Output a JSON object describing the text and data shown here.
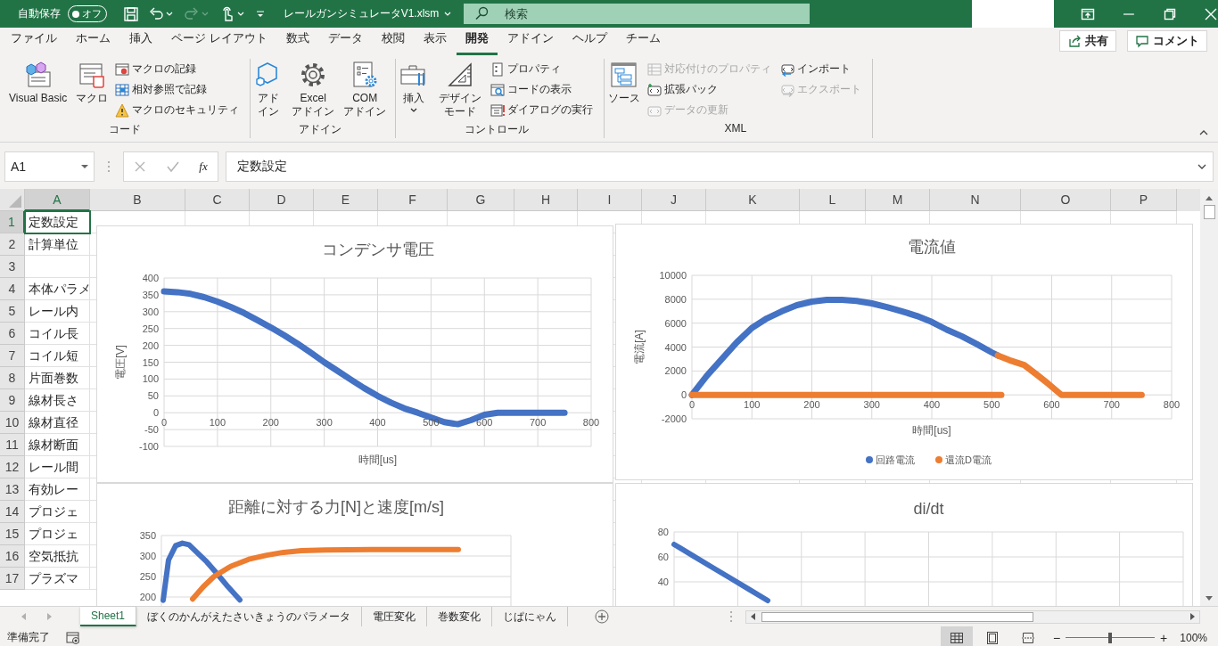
{
  "title_bar": {
    "autosave_label": "自動保存",
    "autosave_toggle": {
      "label": "オフ",
      "on": false
    },
    "file_name": "レールガンシミュレータV1.xlsm",
    "search": {
      "placeholder": "検索"
    }
  },
  "ribbon_tabs": [
    {
      "label": "ファイル",
      "selected": false
    },
    {
      "label": "ホーム",
      "selected": false
    },
    {
      "label": "挿入",
      "selected": false
    },
    {
      "label": "ページ レイアウト",
      "selected": false
    },
    {
      "label": "数式",
      "selected": false
    },
    {
      "label": "データ",
      "selected": false
    },
    {
      "label": "校閲",
      "selected": false
    },
    {
      "label": "表示",
      "selected": false
    },
    {
      "label": "開発",
      "selected": true
    },
    {
      "label": "アドイン",
      "selected": false
    },
    {
      "label": "ヘルプ",
      "selected": false
    },
    {
      "label": "チーム",
      "selected": false
    }
  ],
  "share_button": "共有",
  "comment_button": "コメント",
  "ribbon_groups": [
    {
      "label": "コード",
      "columns": [
        {
          "kind": "large",
          "items": [
            {
              "label": "Visual Basic",
              "disabled": false,
              "dropdown": false
            }
          ]
        },
        {
          "kind": "large",
          "items": [
            {
              "label": "マクロ",
              "disabled": false,
              "dropdown": false
            }
          ]
        },
        {
          "kind": "small",
          "items": [
            {
              "label": "マクロの記録",
              "disabled": false
            },
            {
              "label": "相対参照で記録",
              "disabled": false
            },
            {
              "label": "マクロのセキュリティ",
              "disabled": false
            }
          ]
        }
      ]
    },
    {
      "label": "アドイン",
      "columns": [
        {
          "kind": "large",
          "items": [
            {
              "label": "アドイン",
              "disabled": false,
              "dropdown": false
            }
          ]
        },
        {
          "kind": "large",
          "items": [
            {
              "label": "Excel\nアドイン",
              "disabled": false,
              "dropdown": false
            }
          ]
        },
        {
          "kind": "large",
          "items": [
            {
              "label": "COM\nアドイン",
              "disabled": false,
              "dropdown": false
            }
          ]
        }
      ]
    },
    {
      "label": "コントロール",
      "columns": [
        {
          "kind": "large",
          "items": [
            {
              "label": "挿入",
              "disabled": false,
              "dropdown": true
            }
          ]
        },
        {
          "kind": "large",
          "items": [
            {
              "label": "デザインモード",
              "disabled": false,
              "dropdown": false
            }
          ]
        },
        {
          "kind": "small",
          "items": [
            {
              "label": "プロパティ",
              "disabled": false
            },
            {
              "label": "コードの表示",
              "disabled": false
            },
            {
              "label": "ダイアログの実行",
              "disabled": false
            }
          ]
        }
      ]
    },
    {
      "label": "XML",
      "columns": [
        {
          "kind": "large",
          "items": [
            {
              "label": "ソース",
              "disabled": false,
              "dropdown": false
            }
          ]
        },
        {
          "kind": "small",
          "items": [
            {
              "label": "対応付けのプロパティ",
              "disabled": true
            },
            {
              "label": "拡張パック",
              "disabled": false
            },
            {
              "label": "データの更新",
              "disabled": true
            }
          ]
        },
        {
          "kind": "small",
          "items": [
            {
              "label": "インポート",
              "disabled": false
            },
            {
              "label": "エクスポート",
              "disabled": true
            }
          ]
        }
      ]
    }
  ],
  "formula_bar": {
    "name_box": "A1",
    "function_button": "fx",
    "formula": "定数設定"
  },
  "columns": [
    {
      "label": "A",
      "selected": true
    },
    {
      "label": "B",
      "selected": false
    },
    {
      "label": "C",
      "selected": false
    },
    {
      "label": "D",
      "selected": false
    },
    {
      "label": "E",
      "selected": false
    },
    {
      "label": "F",
      "selected": false
    },
    {
      "label": "G",
      "selected": false
    },
    {
      "label": "H",
      "selected": false
    },
    {
      "label": "I",
      "selected": false
    },
    {
      "label": "J",
      "selected": false
    },
    {
      "label": "K",
      "selected": false
    },
    {
      "label": "L",
      "selected": false
    },
    {
      "label": "M",
      "selected": false
    },
    {
      "label": "N",
      "selected": false
    },
    {
      "label": "O",
      "selected": false
    },
    {
      "label": "P",
      "selected": false
    }
  ],
  "rows": [
    {
      "header": "1",
      "selected": true,
      "column_a": "定数設定"
    },
    {
      "header": "2",
      "selected": false,
      "column_a": "計算単位"
    },
    {
      "header": "3",
      "selected": false
    },
    {
      "header": "4",
      "selected": false,
      "column_a": "本体パラメ"
    },
    {
      "header": "5",
      "selected": false,
      "column_a": "レール内"
    },
    {
      "header": "6",
      "selected": false,
      "column_a": "コイル長"
    },
    {
      "header": "7",
      "selected": false,
      "column_a": "コイル短"
    },
    {
      "header": "8",
      "selected": false,
      "column_a": "片面巻数"
    },
    {
      "header": "9",
      "selected": false,
      "column_a": "線材長さ"
    },
    {
      "header": "10",
      "selected": false,
      "column_a": "線材直径"
    },
    {
      "header": "11",
      "selected": false,
      "column_a": "線材断面"
    },
    {
      "header": "12",
      "selected": false,
      "column_a": "レール間"
    },
    {
      "header": "13",
      "selected": false,
      "column_a": "有効レー"
    },
    {
      "header": "14",
      "selected": false,
      "column_a": "プロジェ"
    },
    {
      "header": "15",
      "selected": false,
      "column_a": "プロジェ"
    },
    {
      "header": "16",
      "selected": false,
      "column_a": "空気抵抗"
    },
    {
      "header": "17",
      "selected": false,
      "column_a": "プラズマ"
    }
  ],
  "charts": [
    {
      "chart_data": {
        "type": "line",
        "title": "コンデンサ電圧",
        "xlabel": "時間[us]",
        "ylabel": "電圧[V]",
        "grid": true,
        "xlim": [
          0,
          800
        ],
        "ylim": [
          -100,
          400
        ],
        "xticks": [
          0,
          100,
          200,
          300,
          400,
          500,
          600,
          700,
          800
        ],
        "yticks": [
          -100,
          -50,
          0,
          50,
          100,
          150,
          200,
          250,
          300,
          350,
          400
        ],
        "x": [
          0,
          25,
          50,
          75,
          100,
          125,
          150,
          175,
          200,
          225,
          250,
          275,
          300,
          325,
          350,
          375,
          400,
          425,
          450,
          475,
          500,
          525,
          550,
          575,
          600,
          625,
          650,
          675,
          700,
          725,
          750
        ],
        "series": [
          {
            "color": "#4472c4",
            "values": [
              360,
              358,
              353,
              343,
              330,
              314,
              296,
              275,
              253,
              230,
              205,
              178,
              150,
              124,
              98,
              73,
              50,
              30,
              13,
              0,
              -14,
              -28,
              -34,
              -22,
              -6,
              0,
              0,
              0,
              0,
              0,
              0
            ]
          }
        ]
      }
    },
    {
      "chart_data": {
        "type": "line",
        "title": "電流値",
        "xlabel": "時間[us]",
        "ylabel": "電流[A]",
        "grid": true,
        "legend": true,
        "xlim": [
          0,
          800
        ],
        "ylim": [
          -2000,
          10000
        ],
        "xticks": [
          0,
          100,
          200,
          300,
          400,
          500,
          600,
          700,
          800
        ],
        "yticks": [
          -2000,
          0,
          2000,
          4000,
          6000,
          8000,
          10000
        ],
        "series": [
          {
            "name": "回路電流",
            "color": "#4472c4",
            "x": [
              0,
              25,
              50,
              75,
              100,
              125,
              150,
              175,
              200,
              225,
              250,
              275,
              300,
              325,
              350,
              375,
              400,
              425,
              450,
              475,
              500,
              510
            ],
            "values": [
              0,
              1600,
              3000,
              4400,
              5600,
              6400,
              7000,
              7500,
              7800,
              7950,
              7950,
              7850,
              7650,
              7350,
              7000,
              6600,
              6100,
              5450,
              4900,
              4250,
              3550,
              3300
            ]
          },
          {
            "name": "還流D電流",
            "color": "#ed7d31",
            "x": [
              0,
              100,
              200,
              300,
              400,
              500,
              516,
              510,
              530,
              554,
              575,
              595,
              616,
              650,
              700,
              750
            ],
            "values": [
              0,
              0,
              0,
              0,
              0,
              0,
              0,
              3300,
              2900,
              2500,
              1700,
              900,
              0,
              0,
              0,
              0
            ]
          }
        ]
      }
    },
    {
      "title": "距離に対する力[N]と速度[m/s]",
      "y_axis_labels": [
        "350",
        "300",
        "250",
        "200"
      ]
    },
    {
      "title": "di/dt",
      "y_axis_labels": [
        "80",
        "60",
        "40"
      ]
    }
  ],
  "sheet_tabs": [
    {
      "label": "Sheet1",
      "selected": true
    },
    {
      "label": "ぼくのかんがえたさいきょうのパラメータ",
      "selected": false
    },
    {
      "label": "電圧変化",
      "selected": false
    },
    {
      "label": "巻数変化",
      "selected": false
    },
    {
      "label": "じぱにゃん",
      "selected": false
    }
  ],
  "status_bar": {
    "text": "準備完了",
    "views": [
      {
        "selected": true
      },
      {
        "selected": false
      },
      {
        "selected": false
      }
    ],
    "zoom_out": "−",
    "zoom": {
      "level": 0.5
    },
    "zoom_in": "+",
    "zoom_reading": "100%"
  }
}
